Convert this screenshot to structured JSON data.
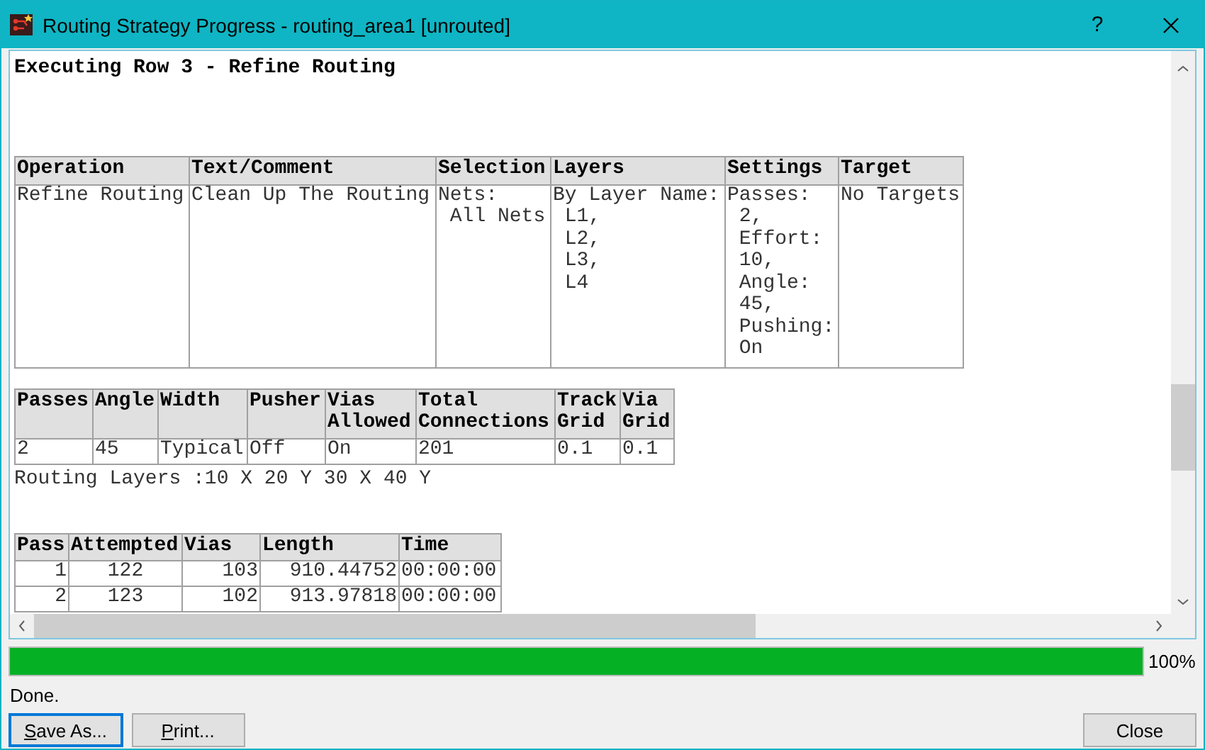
{
  "window": {
    "title": "Routing Strategy Progress - routing_area1 [unrouted]",
    "help": "?"
  },
  "report": {
    "heading": "Executing Row 3 - Refine Routing",
    "operation_table": {
      "columns": [
        "Operation",
        "Text/Comment",
        "Selection",
        "Layers",
        "Settings",
        "Target"
      ],
      "rows": [
        [
          "Refine Routing",
          "Clean Up The Routing",
          "Nets:\n All Nets",
          "By Layer Name:\n L1,\n L2,\n L3,\n L4",
          "Passes:\n 2,\n Effort:\n 10,\n Angle:\n 45,\n Pushing:\n On",
          "No Targets"
        ]
      ]
    },
    "params_table": {
      "columns": [
        "Passes",
        "Angle",
        "Width",
        "Pusher",
        "Vias\nAllowed",
        "Total\nConnections",
        "Track\nGrid",
        "Via\nGrid"
      ],
      "rows": [
        [
          "2",
          "45",
          "Typical",
          "Off",
          "On",
          "201",
          "0.1",
          "0.1"
        ]
      ]
    },
    "routing_layers": "Routing Layers :10 X 20 Y 30 X 40 Y",
    "pass_table": {
      "columns": [
        "Pass",
        "Attempted",
        "Vias",
        "Length",
        "Time"
      ],
      "rows": [
        [
          "1",
          "122",
          "103",
          "910.44752",
          "00:00:00"
        ],
        [
          "2",
          "123",
          "102",
          "913.97818",
          "00:00:00"
        ]
      ]
    }
  },
  "progress": {
    "level": 1,
    "reading": "100%"
  },
  "status": "Done.",
  "buttons": [
    {
      "label": "Save As...",
      "first_letter_underlined": true,
      "focused": true
    },
    {
      "label": "Print...",
      "first_letter_underlined": true,
      "focused": false
    },
    {
      "label": "Close",
      "first_letter_underlined": false,
      "focused": false
    }
  ]
}
